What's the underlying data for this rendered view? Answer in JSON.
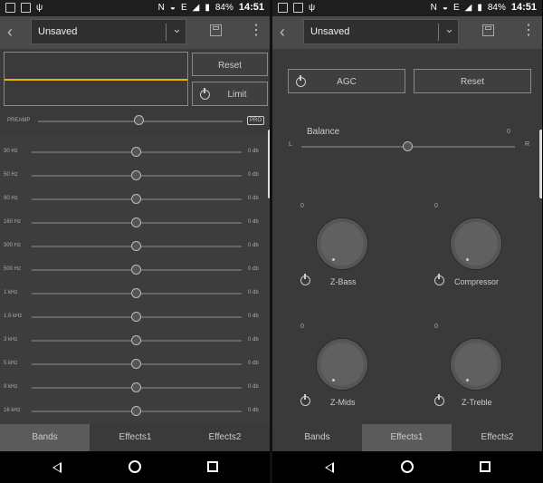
{
  "status": {
    "battery": "84%",
    "time": "14:51",
    "glyph_e": "E"
  },
  "toolbar": {
    "back_icon": "chevron-left-icon",
    "preset": "Unsaved",
    "save_icon": "save-icon",
    "menu_icon": "more-vert-icon"
  },
  "left": {
    "reset": "Reset",
    "limit": "Limit",
    "preamp": "PREAMP",
    "pro": "PRO",
    "bands": [
      {
        "label": "30 Hz",
        "value": "0 db"
      },
      {
        "label": "50 Hz",
        "value": "0 db"
      },
      {
        "label": "90 Hz",
        "value": "0 db"
      },
      {
        "label": "160 Hz",
        "value": "0 db"
      },
      {
        "label": "300 Hz",
        "value": "0 db"
      },
      {
        "label": "500 Hz",
        "value": "0 db"
      },
      {
        "label": "1 kHz",
        "value": "0 db"
      },
      {
        "label": "1.6 kHz",
        "value": "0 db"
      },
      {
        "label": "3 kHz",
        "value": "0 db"
      },
      {
        "label": "5 kHz",
        "value": "0 db"
      },
      {
        "label": "9 kHz",
        "value": "0 db"
      },
      {
        "label": "16 kHz",
        "value": "0 db"
      }
    ]
  },
  "right": {
    "agc": "AGC",
    "reset": "Reset",
    "balance": "Balance",
    "balance_value": "0",
    "l": "L",
    "r": "R",
    "knobs": [
      {
        "value": "0",
        "label": "Z-Bass"
      },
      {
        "value": "0",
        "label": "Compressor"
      },
      {
        "value": "0",
        "label": "Z-Mids"
      },
      {
        "value": "0",
        "label": "Z-Treble"
      }
    ]
  },
  "tabs": [
    "Bands",
    "Effects1",
    "Effects2"
  ],
  "colors": {
    "accent": "#e8b400",
    "panel": "#3a3a3a",
    "active_tab": "#5b5b5b"
  }
}
